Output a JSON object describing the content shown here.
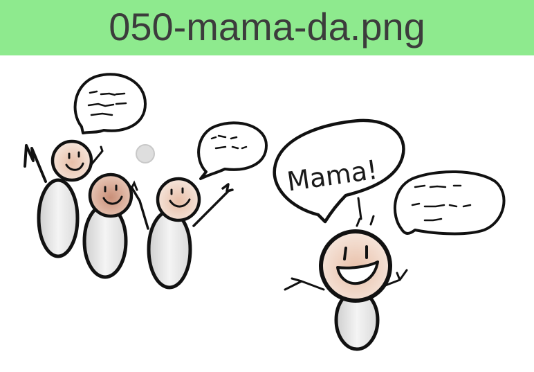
{
  "header": {
    "filename": "050-mama-da.png",
    "background_color": "#8eea8e",
    "text_color": "#3c3c3c"
  },
  "illustration": {
    "speech_bubble_main_text": "Mama!"
  }
}
